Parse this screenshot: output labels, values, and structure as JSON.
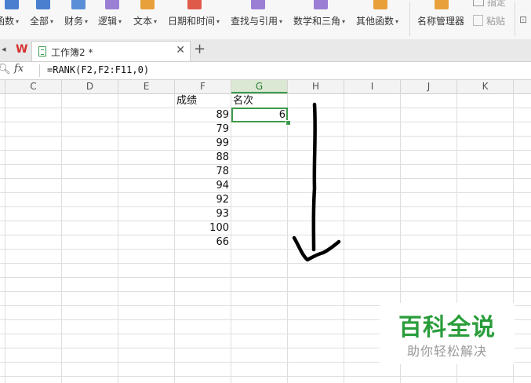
{
  "ribbon": {
    "items": [
      {
        "label": "函数",
        "has_caret": true,
        "icon": "function-icon",
        "color": "#4a7fd0"
      },
      {
        "label": "全部",
        "has_caret": true,
        "icon": "all-functions-icon",
        "color": "#4a7fd0"
      },
      {
        "label": "财务",
        "has_caret": true,
        "icon": "finance-icon",
        "color": "#5a8fd8"
      },
      {
        "label": "逻辑",
        "has_caret": true,
        "icon": "logic-icon",
        "color": "#9b7fd4"
      },
      {
        "label": "文本",
        "has_caret": true,
        "icon": "text-icon",
        "color": "#e8a13a"
      },
      {
        "label": "日期和时间",
        "has_caret": true,
        "icon": "date-time-icon",
        "color": "#e05a4a"
      },
      {
        "label": "查找与引用",
        "has_caret": true,
        "icon": "lookup-icon",
        "color": "#9b7fd4"
      },
      {
        "label": "数学和三角",
        "has_caret": true,
        "icon": "math-icon",
        "color": "#9b7fd4"
      },
      {
        "label": "其他函数",
        "has_caret": true,
        "icon": "other-functions-icon",
        "color": "#e8a13a"
      },
      {
        "label": "名称管理器",
        "has_caret": false,
        "icon": "name-manager-icon",
        "color": "#e8a13a"
      }
    ],
    "side": {
      "top_label": "指定",
      "paste_label": "粘贴"
    }
  },
  "tabs": {
    "app_logo": "W",
    "doc_title": "工作簿2 *",
    "close_glyph": "✕",
    "new_tab_glyph": "+"
  },
  "formula_bar": {
    "fx": "fx",
    "formula": "=RANK(F2,F2:F11,0)"
  },
  "columns": [
    "C",
    "D",
    "E",
    "F",
    "G",
    "H",
    "I",
    "J",
    "K"
  ],
  "selected_column": "G",
  "sheet": {
    "header_score": "成绩",
    "header_rank": "名次",
    "scores": [
      "89",
      "79",
      "99",
      "88",
      "78",
      "94",
      "92",
      "93",
      "100",
      "66"
    ],
    "rank_value": "6"
  },
  "watermark": {
    "main": "百科全说",
    "sub": "助你轻松解决"
  },
  "colors": {
    "accent_green": "#3d9a4c",
    "watermark_green": "#2a9d3b"
  }
}
